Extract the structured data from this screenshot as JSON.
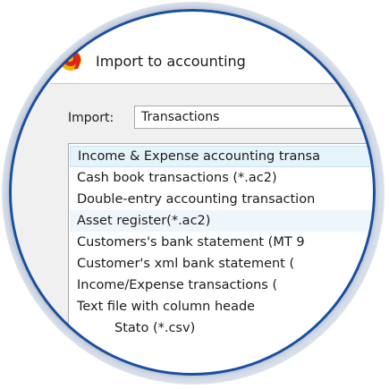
{
  "dialog": {
    "title": "Import to accounting",
    "icon": "app-logo-9-icon"
  },
  "import": {
    "label": "Import:",
    "selected": "Transactions"
  },
  "list": {
    "items": [
      "Income & Expense accounting transa",
      "Cash book transactions (*.ac2)",
      "Double-entry accounting transaction",
      "Asset register(*.ac2)",
      "Customers's bank statement (MT 9",
      "Customer's xml bank statement (",
      "Income/Expense transactions (",
      "Text file with column heade",
      "Stato (*.csv)"
    ],
    "selected_index": 0
  },
  "colors": {
    "ring": "#1a4f9e",
    "icon_red": "#d9261c",
    "icon_yellow": "#f4b400",
    "selection": "#e5f3fb"
  }
}
